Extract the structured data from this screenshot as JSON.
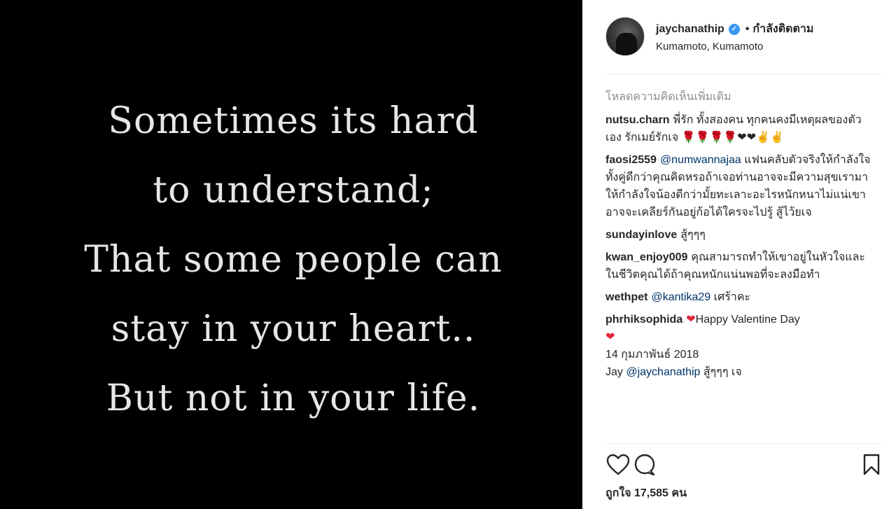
{
  "post_image": {
    "quote_lines": [
      "Sometimes its hard",
      "to understand;",
      "That some people can",
      "stay in your heart..",
      "But not in your life."
    ]
  },
  "header": {
    "username": "jaychanathip",
    "separator": "•",
    "follow_status": "กำลังติดตาม",
    "location": "Kumamoto, Kumamoto"
  },
  "comments": {
    "load_more": "โหลดความคิดเห็นเพิ่มเติม",
    "items": [
      {
        "user": "nutsu.charn",
        "text": "พี่รัก ทั้งสองคน ทุกคนคงมีเหตุผลของตัวเอง รักเมย์รักเจ",
        "emoji": "🌹🌹🌹🌹❤❤✌✌"
      },
      {
        "user": "faosi2559",
        "mention": "@numwannajaa",
        "text": "แฟนคลับตัวจริงให้กำลังใจทั้งคู่ดีกว่าคุณคิดหรอถ้าเจอท่านอาจจะมีความสุขเรามาให้กำลังใจน้องดีกว่ามั้ยทะเลาะอะไรหนักหนาไม่แน่เขาอาจจะเคลียร์กันอยู่ก้อได้ใครจะไปรู้ สู้ไว้ยเจ"
      },
      {
        "user": "sundayinlove",
        "text": "สู้ๆๆๆ"
      },
      {
        "user": "kwan_enjoy009",
        "text": "คุณสามารถทำให้เขาอยู่ในหัวใจและในชีวิตคุณได้ถ้าคุณหนักแน่นพอที่จะลงมือทำ"
      },
      {
        "user": "wethpet",
        "mention": "@kantika29",
        "text": "เศร้าคะ"
      },
      {
        "user": "phrhiksophida",
        "text": "Happy Valentine Day",
        "emoji_before": "❤",
        "emoji_after": "❤"
      }
    ],
    "caption_date": "14 กุมภาพันธ์ 2018",
    "caption": {
      "prefix": "Jay",
      "mention": "@jaychanathip",
      "text": "สู้ๆๆๆ เจ"
    }
  },
  "actions": {
    "like_icon": "heart-icon",
    "comment_icon": "comment-icon",
    "save_icon": "bookmark-icon"
  },
  "likes": {
    "label": "ถูกใจ 17,585 คน"
  },
  "colors": {
    "verified": "#3897f0",
    "mention": "#003569",
    "muted": "#8e8e8e"
  }
}
